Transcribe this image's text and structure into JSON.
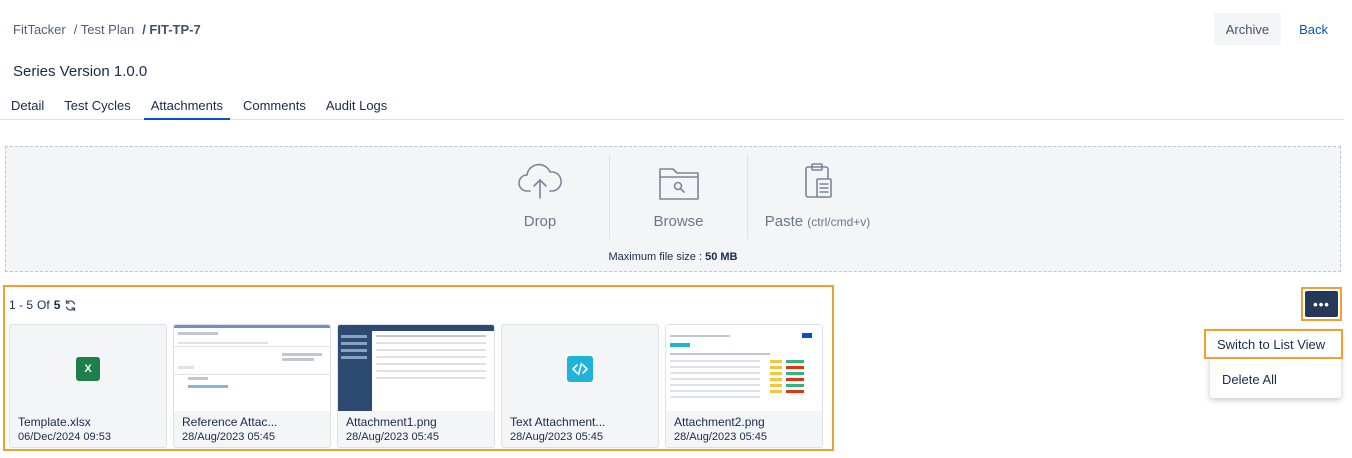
{
  "breadcrumb": {
    "items": [
      "FitTacker",
      "/ Test Plan",
      "/ FIT-TP-7"
    ]
  },
  "actions": {
    "archive_label": "Archive",
    "back_label": "Back"
  },
  "page": {
    "title": "Series Version 1.0.0"
  },
  "tabs": [
    {
      "label": "Detail",
      "active": false
    },
    {
      "label": "Test Cycles",
      "active": false
    },
    {
      "label": "Attachments",
      "active": true
    },
    {
      "label": "Comments",
      "active": false
    },
    {
      "label": "Audit Logs",
      "active": false
    }
  ],
  "dropzone": {
    "drop_label": "Drop",
    "browse_label": "Browse",
    "paste_label": "Paste",
    "paste_hint": "(ctrl/cmd+v)",
    "max_prefix": "Maximum file size :",
    "max_value": "50 MB"
  },
  "pager": {
    "range": "1  -  5",
    "of_label": "Of",
    "total": "5",
    "refresh_icon": "refresh-icon"
  },
  "attachments": [
    {
      "name": "Template.xlsx",
      "date": "06/Dec/2024 09:53",
      "kind": "excel"
    },
    {
      "name": "Reference Attac...",
      "date": "28/Aug/2023 05:45",
      "kind": "screenshot"
    },
    {
      "name": "Attachment1.png",
      "date": "28/Aug/2023 05:45",
      "kind": "screenshot"
    },
    {
      "name": "Text Attachment...",
      "date": "28/Aug/2023 05:45",
      "kind": "code"
    },
    {
      "name": "Attachment2.png",
      "date": "28/Aug/2023 05:45",
      "kind": "screenshot"
    }
  ],
  "more_menu": {
    "button_label": "•••",
    "items": [
      "Switch to List View",
      "Delete All"
    ]
  },
  "colors": {
    "accent": "#0052cc",
    "highlight": "#f0a030",
    "more_button": "#253858",
    "excel": "#1d8049",
    "code": "#1fb3d8"
  }
}
